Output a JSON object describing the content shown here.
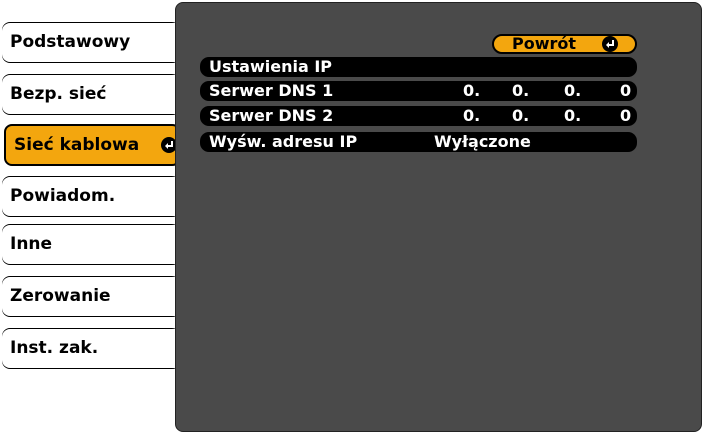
{
  "sidebar": {
    "items": [
      {
        "label": "Podstawowy"
      },
      {
        "label": "Bezp. sieć"
      },
      {
        "label": "Sieć kablowa"
      },
      {
        "label": "Powiadom."
      },
      {
        "label": "Inne"
      },
      {
        "label": "Zerowanie"
      },
      {
        "label": "Inst. zak."
      }
    ],
    "active_index": 2
  },
  "panel": {
    "back_label": "Powrót",
    "rows": [
      {
        "label": "Ustawienia IP",
        "values": []
      },
      {
        "label": "Serwer DNS 1",
        "values": [
          "0.",
          "0.",
          "0.",
          "0"
        ]
      },
      {
        "label": "Serwer DNS 2",
        "values": [
          "0.",
          "0.",
          "0.",
          "0"
        ]
      },
      {
        "label": "Wyśw. adresu IP",
        "value": "Wyłączone"
      }
    ]
  },
  "colors": {
    "accent": "#f3a60e",
    "panel_bg": "#4a4a4a",
    "row_bg": "#000000"
  },
  "icons": {
    "enter": "enter-icon"
  }
}
